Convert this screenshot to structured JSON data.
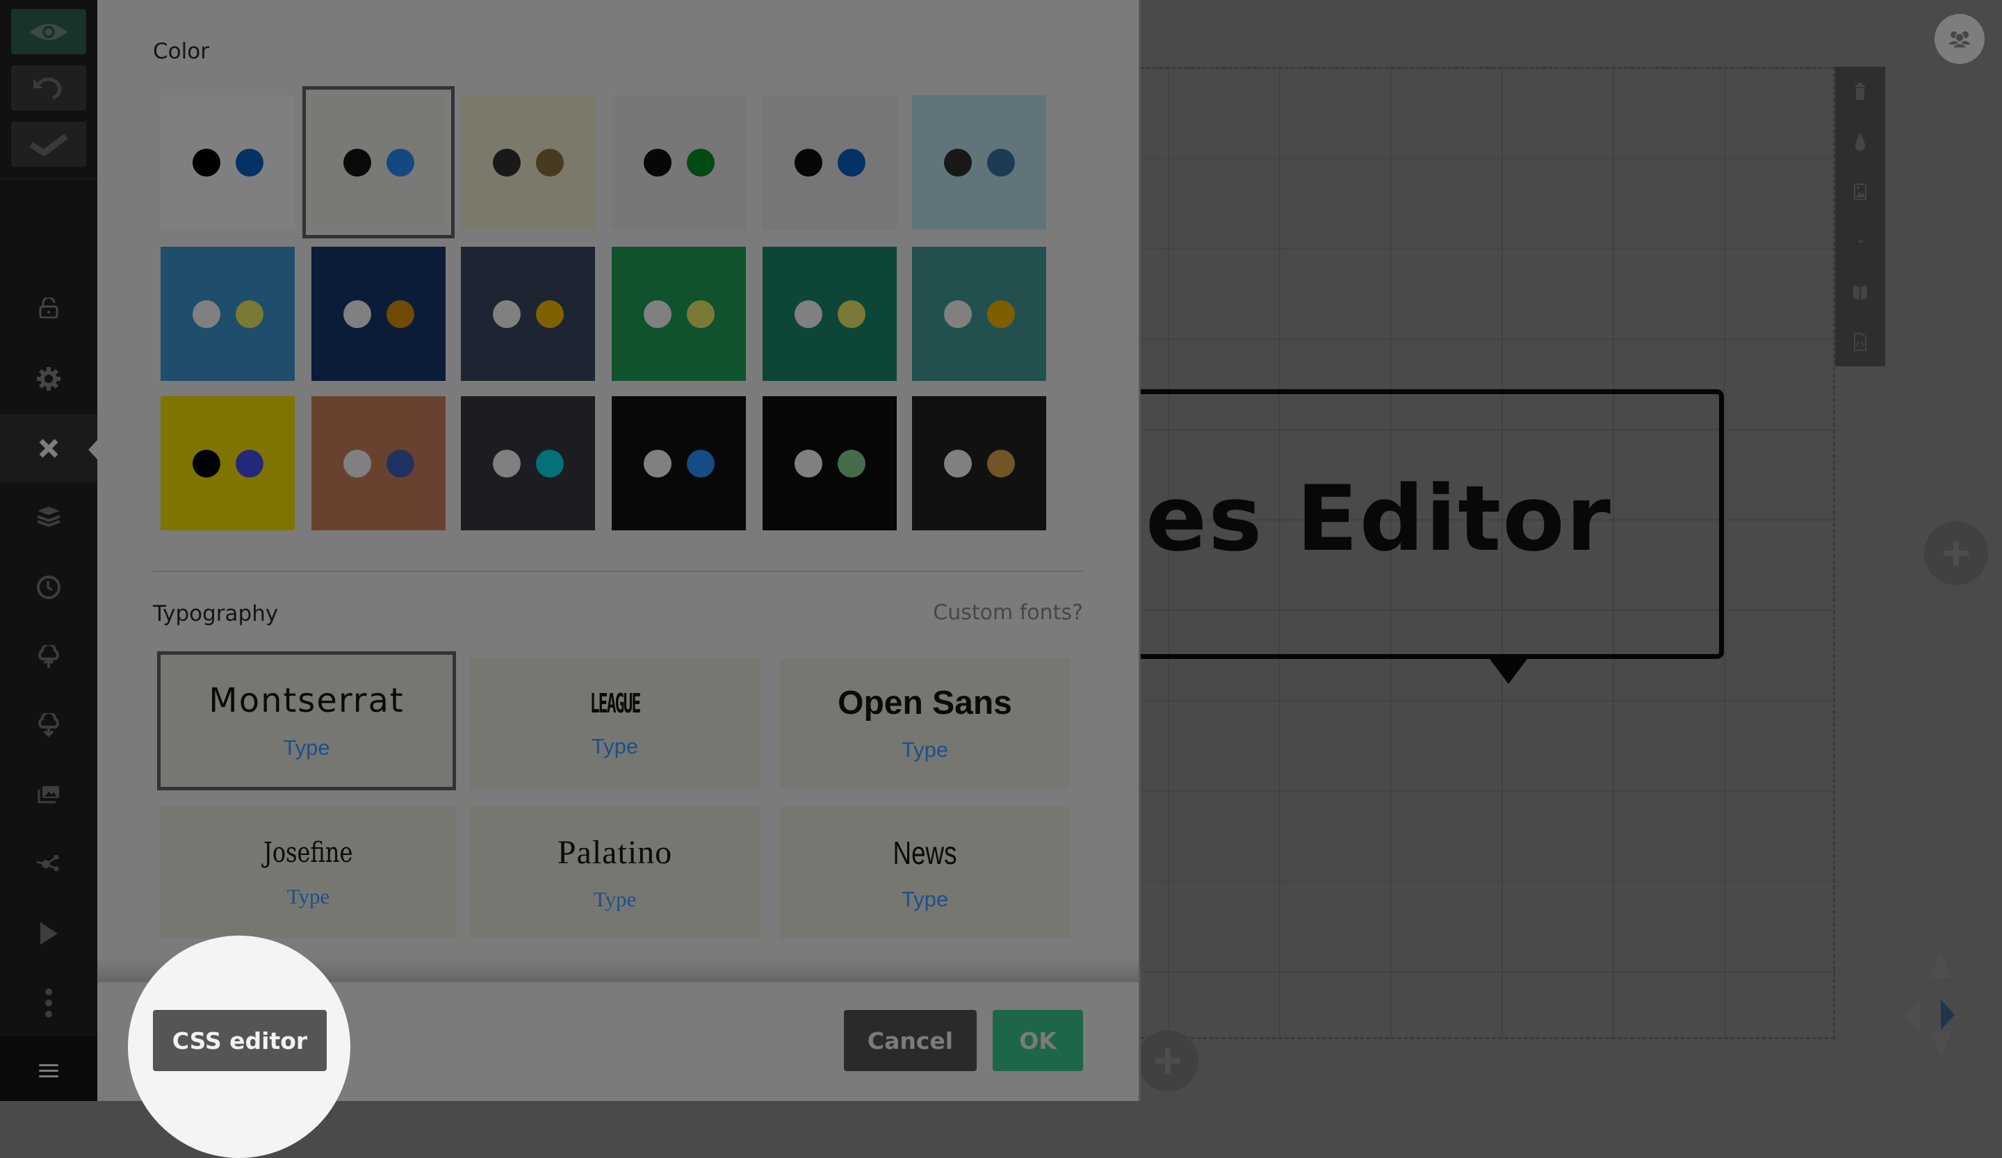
{
  "sidebar": {
    "top_buttons": [
      {
        "name": "preview",
        "icon": "eye-icon"
      },
      {
        "name": "undo",
        "icon": "undo-icon"
      },
      {
        "name": "save",
        "icon": "check-icon"
      }
    ],
    "items": [
      {
        "name": "lock",
        "icon": "lock-icon"
      },
      {
        "name": "settings",
        "icon": "gear-icon"
      },
      {
        "name": "themes",
        "icon": "close-icon",
        "active": true
      },
      {
        "name": "layers",
        "icon": "layers-icon"
      },
      {
        "name": "history",
        "icon": "clock-icon"
      },
      {
        "name": "upload",
        "icon": "cloud-upload-icon"
      },
      {
        "name": "download",
        "icon": "cloud-download-icon"
      },
      {
        "name": "media",
        "icon": "gallery-icon"
      },
      {
        "name": "share",
        "icon": "share-icon"
      },
      {
        "name": "present",
        "icon": "play-icon"
      },
      {
        "name": "more",
        "icon": "more-vertical-icon"
      },
      {
        "name": "menu",
        "icon": "hamburger-icon"
      }
    ]
  },
  "panel": {
    "color_title": "Color",
    "swatches": [
      {
        "bg": "#7f7f7f",
        "dot1": "#000000",
        "dot2": "#053163",
        "selected": false
      },
      {
        "bg": "#797a75",
        "dot1": "#0a0a0a",
        "dot2": "#144880",
        "selected": true
      },
      {
        "bg": "#7b7a6a",
        "dot1": "#191919",
        "dot2": "#463b1f",
        "selected": false
      },
      {
        "bg": "#777777",
        "dot1": "#070707",
        "dot2": "#004a13",
        "selected": false
      },
      {
        "bg": "#767676",
        "dot1": "#070707",
        "dot2": "#043267",
        "selected": false
      },
      {
        "bg": "#61747a",
        "dot1": "#181818",
        "dot2": "#1d3b52",
        "selected": false
      },
      {
        "bg": "#1f4e6c",
        "dot1": "#808080",
        "dot2": "#7a7a34",
        "selected": false
      },
      {
        "bg": "#0a1c38",
        "dot1": "#808080",
        "dot2": "#704a03",
        "selected": false
      },
      {
        "bg": "#1c2531",
        "dot1": "#808080",
        "dot2": "#7f6100",
        "selected": false
      },
      {
        "bg": "#10522b",
        "dot1": "#808080",
        "dot2": "#7a7a36",
        "selected": false
      },
      {
        "bg": "#0d4636",
        "dot1": "#808080",
        "dot2": "#7a7a36",
        "selected": false
      },
      {
        "bg": "#22504f",
        "dot1": "#808080",
        "dot2": "#7f5e00",
        "selected": false
      },
      {
        "bg": "#807400",
        "dot1": "#000000",
        "dot2": "#23287a",
        "selected": false
      },
      {
        "bg": "#68422f",
        "dot1": "#808080",
        "dot2": "#1f3261",
        "selected": false
      },
      {
        "bg": "#1c1d20",
        "dot1": "#808080",
        "dot2": "#047079",
        "selected": false
      },
      {
        "bg": "#080808",
        "dot1": "#808080",
        "dot2": "#154c85",
        "selected": false
      },
      {
        "bg": "#060606",
        "dot1": "#808080",
        "dot2": "#446c4a",
        "selected": false
      },
      {
        "bg": "#111111",
        "dot1": "#808080",
        "dot2": "#735427",
        "selected": false
      }
    ],
    "typography_title": "Typography",
    "custom_fonts_link": "Custom fonts?",
    "fonts": [
      {
        "name": "Montserrat",
        "sample": "Type",
        "selected": true
      },
      {
        "name": "LEAGUE",
        "sample": "Type",
        "selected": false
      },
      {
        "name": "Open Sans",
        "sample": "Type",
        "selected": false
      },
      {
        "name": "Josefine",
        "sample": "Type",
        "selected": false
      },
      {
        "name": "Palatino",
        "sample": "Type",
        "selected": false
      },
      {
        "name": "News",
        "sample": "Type",
        "selected": false
      }
    ],
    "footer": {
      "css_editor": "CSS editor",
      "cancel": "Cancel",
      "ok": "OK"
    }
  },
  "canvas": {
    "textbox_text": "es Editor"
  },
  "colors": {
    "accent_green": "#1d6647",
    "cancel_bg": "#2a2a2a",
    "css_editor_bg": "#555555",
    "link_blue": "#1d4f8a"
  }
}
